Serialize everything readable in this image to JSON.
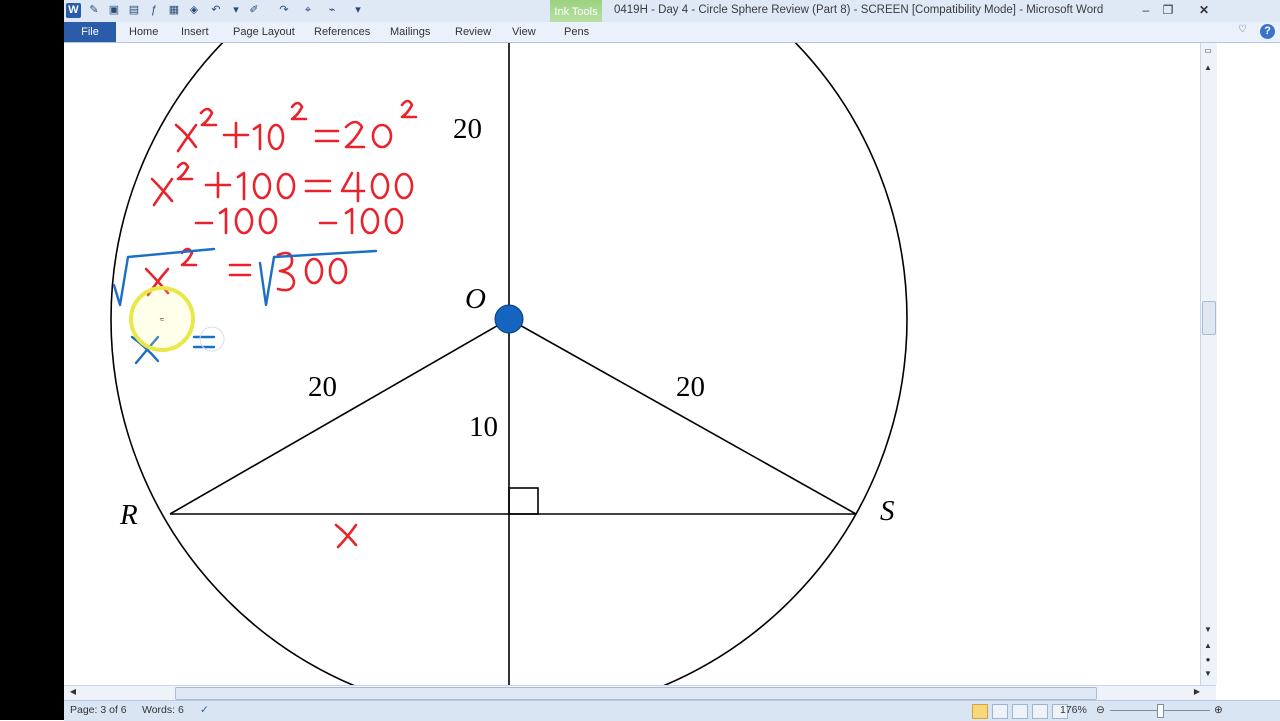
{
  "titlebar": {
    "app_title": "0419H - Day 4 - Circle Sphere Review (Part 8) - SCREEN [Compatibility Mode]  -  Microsoft Word",
    "contextual_tab_group": "Ink Tools",
    "word_logo": "W"
  },
  "ribbon": {
    "file_tab": "File",
    "tabs": [
      "Home",
      "Insert",
      "Page Layout",
      "References",
      "Mailings",
      "Review",
      "View",
      "Pens"
    ]
  },
  "document": {
    "labels": {
      "top_radius": "20",
      "center": "O",
      "left_radius": "20",
      "right_radius": "20",
      "distance": "10",
      "point_r": "R",
      "point_s": "S"
    },
    "ink_color": "#e8232c",
    "ink_blue": "#1b6fc4",
    "center_dot_color": "#1565c0"
  },
  "statusbar": {
    "page": "Page: 3 of 6",
    "words": "Words: 6",
    "zoom": "176%"
  },
  "icons": [
    "word-logo-icon",
    "save-icon",
    "undo-icon",
    "redo-icon",
    "minimize-icon",
    "restore-icon",
    "close-icon",
    "help-icon",
    "proofing-icon",
    "zoom-out-icon",
    "zoom-in-icon"
  ]
}
